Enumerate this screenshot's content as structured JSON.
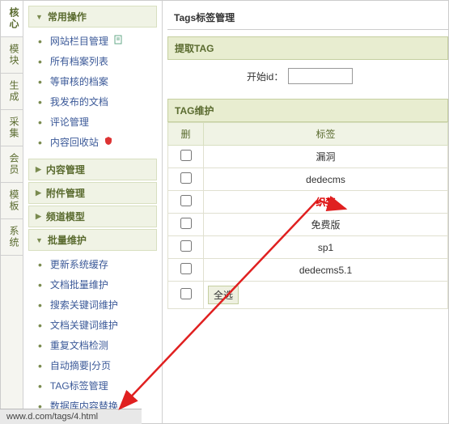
{
  "vtabs": [
    "核心",
    "模块",
    "生成",
    "采集",
    "会员",
    "模板",
    "系统"
  ],
  "sidebar": {
    "sections": [
      {
        "title": "常用操作",
        "open": true,
        "items": [
          "网站栏目管理",
          "所有档案列表",
          "等审核的档案",
          "我发布的文档",
          "评论管理",
          "内容回收站"
        ],
        "icons": {
          "0": "file",
          "5": "shield"
        }
      },
      {
        "title": "内容管理",
        "open": false
      },
      {
        "title": "附件管理",
        "open": false
      },
      {
        "title": "频道模型",
        "open": false
      },
      {
        "title": "批量维护",
        "open": true,
        "items": [
          "更新系统缓存",
          "文档批量维护",
          "搜索关键词维护",
          "文档关键词维护",
          "重复文档检测",
          "自动摘要|分页",
          "TAG标签管理",
          "数据库内容替换"
        ]
      }
    ]
  },
  "main": {
    "title": "Tags标签管理",
    "extract_header": "提取TAG",
    "start_id_label": "开始id：",
    "maint_header": "TAG维护",
    "columns": {
      "del": "删",
      "tag": "标签"
    },
    "rows": [
      {
        "tag": "漏洞"
      },
      {
        "tag": "dedecms"
      },
      {
        "tag": "织梦",
        "highlight": true
      },
      {
        "tag": "免费版"
      },
      {
        "tag": "sp1"
      },
      {
        "tag": "dedecms5.1"
      }
    ],
    "select_all": "全选"
  },
  "status_url": "www.d.com/tags/4.html"
}
